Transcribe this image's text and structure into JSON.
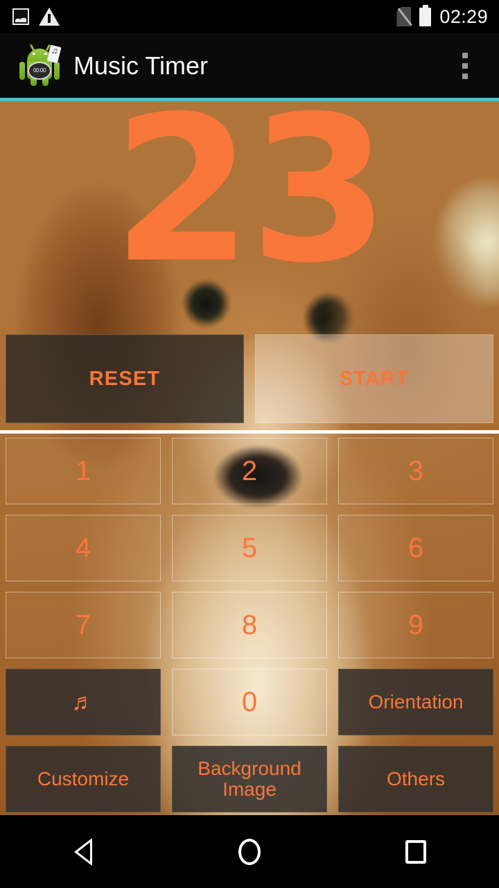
{
  "status_bar": {
    "icons_left": [
      "image-icon",
      "warning-icon"
    ],
    "icons_right": [
      "no-sim-icon",
      "battery-icon"
    ],
    "time": "02:29"
  },
  "app_bar": {
    "icon": "android-music-timer-icon",
    "icon_stopwatch_text": "00:00",
    "title": "Music Timer",
    "overflow": "overflow-menu-icon"
  },
  "theme": {
    "accent_line": "#56b9d6",
    "orange": "#f9763b",
    "dark_button": "rgba(52,48,44,0.88)",
    "status_bar_bg": "#000000"
  },
  "timer": {
    "value": "23"
  },
  "controls": {
    "reset_label": "RESET",
    "start_label": "START"
  },
  "keypad": [
    {
      "name": "key-1",
      "label": "1",
      "style": "transparent"
    },
    {
      "name": "key-2",
      "label": "2",
      "style": "transparent"
    },
    {
      "name": "key-3",
      "label": "3",
      "style": "transparent"
    },
    {
      "name": "key-4",
      "label": "4",
      "style": "transparent"
    },
    {
      "name": "key-5",
      "label": "5",
      "style": "transparent"
    },
    {
      "name": "key-6",
      "label": "6",
      "style": "transparent"
    },
    {
      "name": "key-7",
      "label": "7",
      "style": "transparent"
    },
    {
      "name": "key-8",
      "label": "8",
      "style": "transparent"
    },
    {
      "name": "key-9",
      "label": "9",
      "style": "transparent"
    },
    {
      "name": "key-music",
      "label": "♬",
      "style": "dark"
    },
    {
      "name": "key-0",
      "label": "0",
      "style": "transparent"
    },
    {
      "name": "key-orientation",
      "label": "Orientation",
      "style": "dark"
    },
    {
      "name": "key-customize",
      "label": "Customize",
      "style": "dark"
    },
    {
      "name": "key-background-image",
      "label": "Background Image",
      "style": "dark"
    },
    {
      "name": "key-others",
      "label": "Others",
      "style": "dark"
    }
  ],
  "nav_bar": {
    "back": "back-icon",
    "home": "home-icon",
    "recents": "recents-icon"
  }
}
